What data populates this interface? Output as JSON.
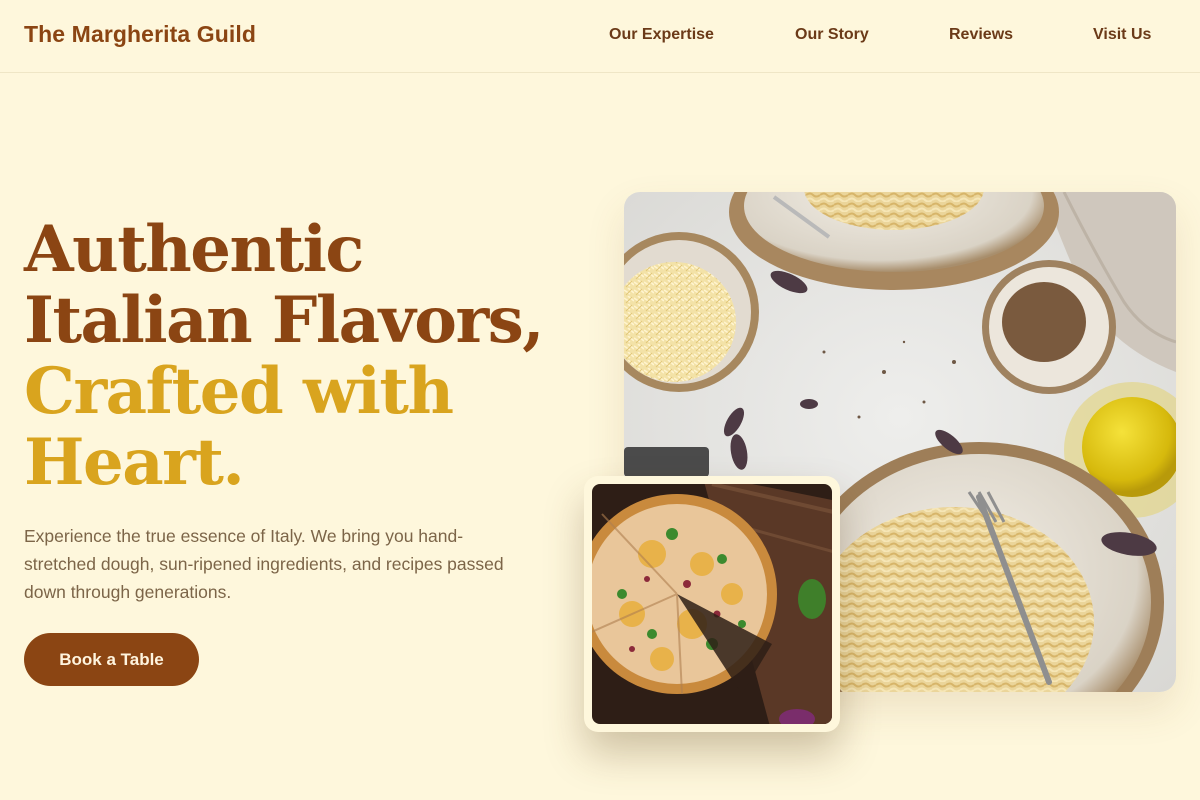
{
  "brand": "The Margherita Guild",
  "nav": {
    "links": [
      "Our Expertise",
      "Our Story",
      "Reviews",
      "Visit Us"
    ]
  },
  "hero": {
    "headline_dark": [
      "Authentic",
      "Italian Flavors,"
    ],
    "headline_gold": [
      "Crafted with",
      "Heart."
    ],
    "lead": "Experience the true essence of Italy. We bring you hand-stretched dough, sun-ripened ingredients, and recipes passed down through generations.",
    "cta_label": "Book a Table"
  },
  "colors": {
    "background": "#FEF7DC",
    "primary": "#8B4513",
    "accent": "#D9A41E",
    "body_text": "#7C6548"
  },
  "images": {
    "main": "pasta-table-photo",
    "inset": "pizza-board-photo"
  }
}
